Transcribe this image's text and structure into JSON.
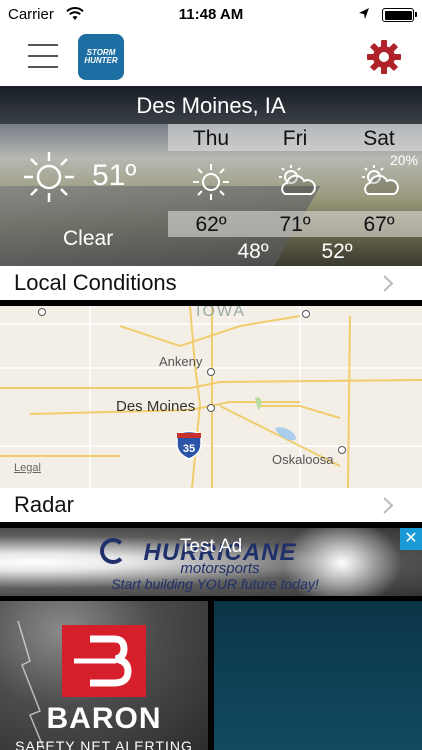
{
  "status_bar": {
    "carrier": "Carrier",
    "time": "11:48 AM"
  },
  "nav": {
    "logo_text_1": "STORM",
    "logo_text_2": "HUNTER"
  },
  "weather": {
    "city": "Des Moines, IA",
    "current_temp": "51º",
    "current_condition": "Clear",
    "forecast": [
      {
        "day": "Thu",
        "icon": "sun-icon",
        "high": "62º",
        "low": "48º",
        "precip": ""
      },
      {
        "day": "Fri",
        "icon": "partly-cloudy-icon",
        "high": "71º",
        "low": "52º",
        "precip": ""
      },
      {
        "day": "Sat",
        "icon": "partly-cloudy-icon",
        "high": "67º",
        "low": "",
        "precip": "20%"
      }
    ]
  },
  "local_conditions": {
    "label": "Local Conditions"
  },
  "map": {
    "state_label": "IOWA",
    "towns": [
      "Ankeny",
      "Des Moines",
      "Oskaloosa"
    ],
    "shield": "35",
    "legal": "Legal"
  },
  "radar": {
    "label": "Radar"
  },
  "ad": {
    "label": "Test Ad",
    "brand": "HURRICANE",
    "brand_sub": "motorsports",
    "tagline": "Start building YOUR future today!",
    "close": "✕"
  },
  "tiles": {
    "baron_word": "BARON",
    "baron_sub": "SAFETY NET ALERTING"
  },
  "colors": {
    "gear": "#b0222a",
    "ad_close": "#1a9ad6",
    "baron_red": "#d51f2b"
  }
}
